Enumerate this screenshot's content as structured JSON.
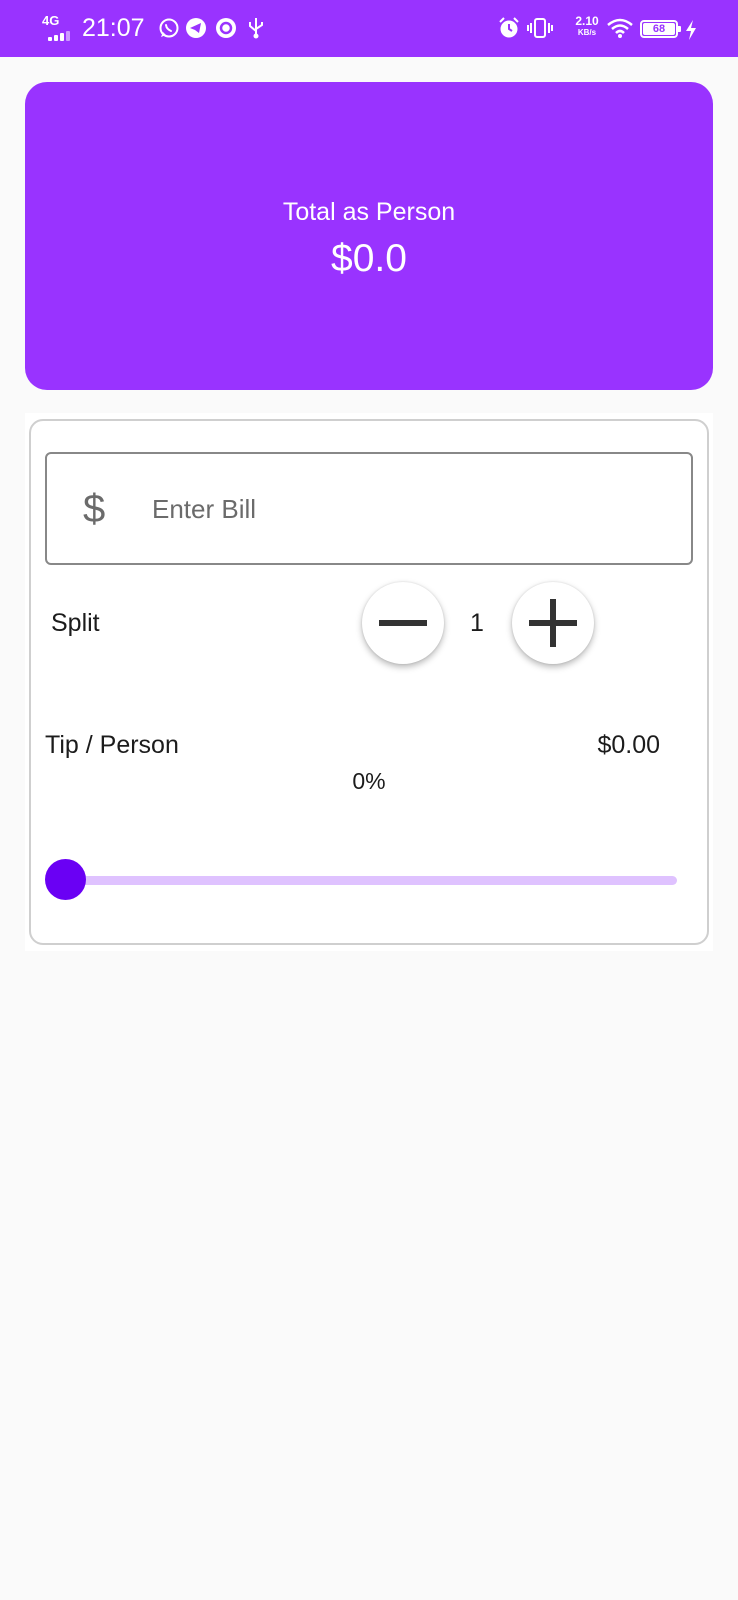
{
  "status_bar": {
    "network": "4G",
    "time": "21:07",
    "net_speed": "2.10",
    "net_speed_unit": "KB/s",
    "battery": "68",
    "left_icons": [
      "whatsapp-icon",
      "telegram-icon",
      "circle-app-icon",
      "usb-icon"
    ],
    "right_icons": [
      "alarm-icon",
      "vibrate-icon",
      "wifi-icon",
      "battery-icon",
      "charging-icon"
    ]
  },
  "total_card": {
    "label": "Total as Person",
    "amount": "$0.0"
  },
  "bill": {
    "currency_symbol": "$",
    "value": "",
    "placeholder": "Enter Bill"
  },
  "split": {
    "label": "Split",
    "count": "1"
  },
  "tip": {
    "label": "Tip / Person",
    "amount": "$0.00",
    "percent_text": "0%",
    "slider_value": 0
  },
  "colors": {
    "primary": "#9933ff",
    "accent": "#6a00f4",
    "slider_track": "#dfc2ff",
    "background": "#fafafa"
  }
}
